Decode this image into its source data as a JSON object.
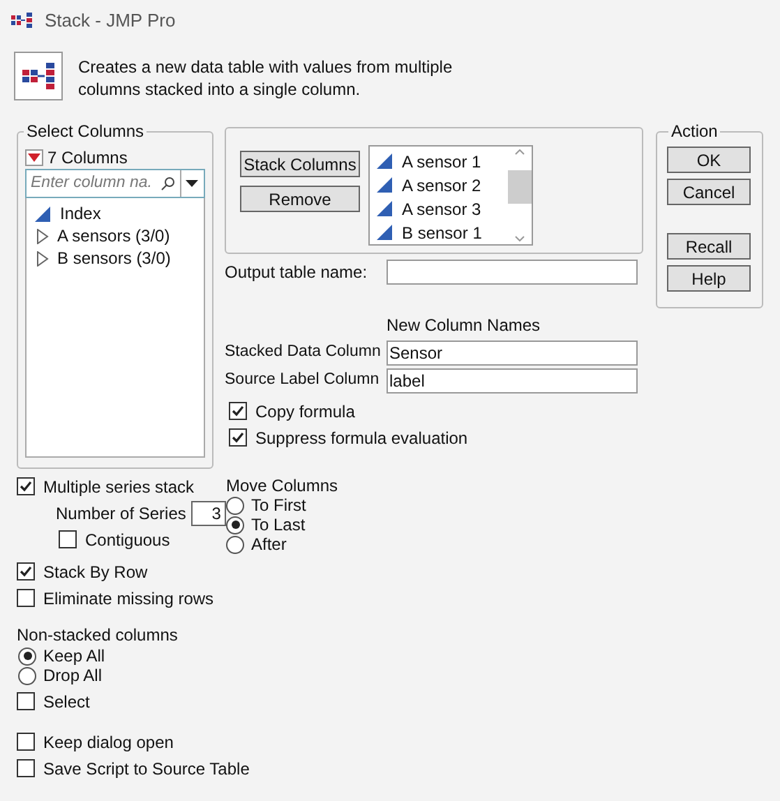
{
  "window": {
    "title": "Stack - JMP Pro"
  },
  "description": "Creates a new data table with values from multiple columns stacked into a single column.",
  "select_columns": {
    "title": "Select Columns",
    "count": "7 Columns",
    "search": {
      "placeholder": "Enter column na."
    },
    "items": [
      {
        "name": "Index",
        "kind": "column"
      },
      {
        "name": "A sensors (3/0)",
        "kind": "group",
        "expanded": false
      },
      {
        "name": "B sensors (3/0)",
        "kind": "group",
        "expanded": false
      }
    ]
  },
  "stack_buttons": [
    "Stack Columns",
    "Remove"
  ],
  "stacked_columns": [
    "A sensor 1",
    "A sensor 2",
    "A sensor 3",
    "B sensor 1"
  ],
  "output_table": {
    "label": "Output table name:"
  },
  "new_column_names": {
    "heading": "New Column Names",
    "fields": [
      {
        "label": "Stacked Data Column",
        "value": "Sensor"
      },
      {
        "label": "Source Label Column",
        "value": "label"
      }
    ]
  },
  "formula_options": [
    {
      "label": "Copy formula",
      "checked": true
    },
    {
      "label": "Suppress formula evaluation",
      "checked": true
    }
  ],
  "action": {
    "title": "Action",
    "groups": [
      [
        "OK",
        "Cancel"
      ],
      [
        "Recall",
        "Help"
      ]
    ]
  },
  "multiple_series": {
    "label": "Multiple series stack",
    "checked": true,
    "number_label": "Number of Series",
    "number": "3",
    "contiguous": {
      "label": "Contiguous",
      "checked": false
    }
  },
  "stack_options": [
    {
      "label": "Stack By Row",
      "checked": true
    },
    {
      "label": "Eliminate missing rows",
      "checked": false
    }
  ],
  "move_columns": {
    "title": "Move Columns",
    "options": [
      {
        "label": "To First",
        "selected": false
      },
      {
        "label": "To Last",
        "selected": true
      },
      {
        "label": "After",
        "selected": false
      }
    ]
  },
  "non_stacked": {
    "title": "Non-stacked columns",
    "options": [
      {
        "label": "Keep All",
        "selected": true
      },
      {
        "label": "Drop All",
        "selected": false
      }
    ],
    "select": {
      "label": "Select",
      "checked": false
    }
  },
  "dialog_options": [
    {
      "label": "Keep dialog open",
      "checked": false
    },
    {
      "label": "Save Script to Source Table",
      "checked": false
    }
  ]
}
